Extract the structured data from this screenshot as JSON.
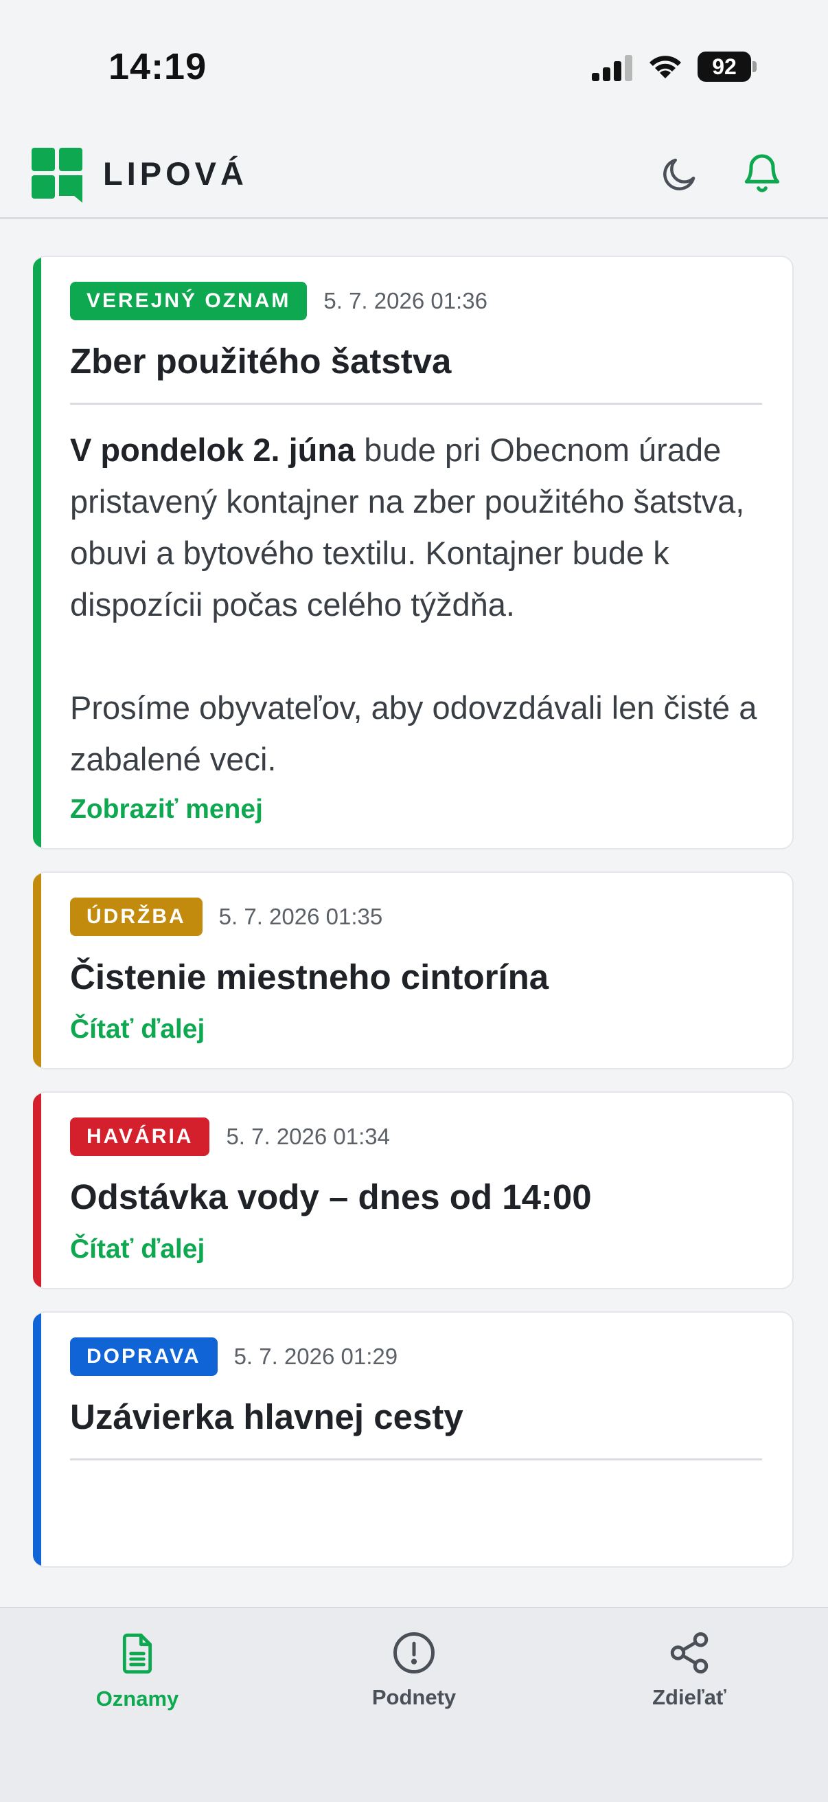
{
  "status_bar": {
    "time": "14:19",
    "battery": "92",
    "icons": [
      "signal-icon",
      "wifi-icon",
      "battery-icon"
    ]
  },
  "header": {
    "title": "LIPOVÁ",
    "icons": [
      "logo-icon",
      "moon-icon",
      "bell-icon"
    ]
  },
  "colors": {
    "green": "#0da850",
    "amber": "#c38b0e",
    "red": "#d4202c",
    "blue": "#1064d6"
  },
  "announcements": [
    {
      "badge": "VEREJNÝ OZNAM",
      "timestamp": "5. 7. 2026 01:36",
      "title": "Zber použitého šatstva",
      "body_bold": "V pondelok 2. júna",
      "body_rest": " bude pri Obecnom úrade pristavený kontajner na zber použitého šatstva, obuvi a bytového textilu. Kontajner bude k dispozícii počas celého týždňa.",
      "body_second": "Prosíme obyvateľov, aby odovzdávali len čisté a zabalené veci.",
      "link": "Zobraziť menej"
    },
    {
      "badge": "ÚDRŽBA",
      "timestamp": "5. 7. 2026 01:35",
      "title": "Čistenie miestneho cintorína",
      "link": "Čítať ďalej"
    },
    {
      "badge": "HAVÁRIA",
      "timestamp": "5. 7. 2026 01:34",
      "title": "Odstávka vody – dnes od 14:00",
      "link": "Čítať ďalej"
    },
    {
      "badge": "DOPRAVA",
      "timestamp": "5. 7. 2026 01:29",
      "title": "Uzávierka hlavnej cesty"
    }
  ],
  "bottom_nav": [
    {
      "label": "Oznamy",
      "icon": "document-icon",
      "active": true
    },
    {
      "label": "Podnety",
      "icon": "alert-circle-icon",
      "active": false
    },
    {
      "label": "Zdieľať",
      "icon": "share-icon",
      "active": false
    }
  ]
}
